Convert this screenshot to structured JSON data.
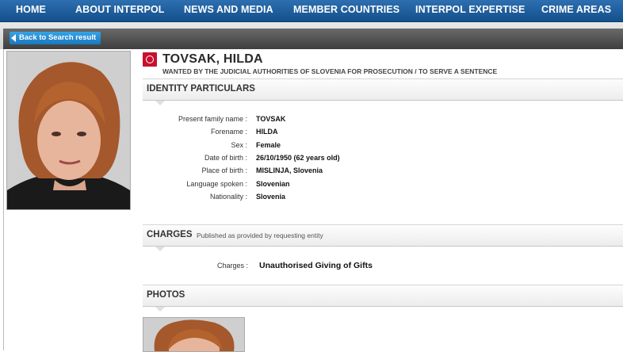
{
  "nav": {
    "items": [
      "HOME",
      "ABOUT INTERPOL",
      "NEWS AND MEDIA",
      "MEMBER COUNTRIES",
      "INTERPOL EXPERTISE",
      "CRIME AREAS"
    ]
  },
  "toolbar": {
    "back_label": "Back to Search result"
  },
  "header": {
    "name": "TOVSAK, HILDA",
    "wanted": "WANTED BY THE JUDICIAL AUTHORITIES OF SLOVENIA FOR PROSECUTION / TO SERVE A SENTENCE"
  },
  "identity": {
    "title": "IDENTITY PARTICULARS",
    "rows": [
      {
        "label": "Present family name :",
        "value": "TOVSAK"
      },
      {
        "label": "Forename :",
        "value": "HILDA"
      },
      {
        "label": "Sex :",
        "value": "Female"
      },
      {
        "label": "Date of birth :",
        "value": "26/10/1950 (62 years old)"
      },
      {
        "label": "Place of birth :",
        "value": "MISLINJA, Slovenia"
      },
      {
        "label": "Language spoken :",
        "value": "Slovenian"
      },
      {
        "label": "Nationality :",
        "value": "Slovenia"
      }
    ]
  },
  "charges": {
    "title": "CHARGES",
    "subtitle": "Published as provided by requesting entity",
    "label": "Charges :",
    "value": "Unauthorised Giving of Gifts"
  },
  "photos": {
    "title": "PHOTOS"
  },
  "colors": {
    "nav": "#1f5f9f",
    "accent": "#1b78bd",
    "notice_red": "#c8102e"
  }
}
